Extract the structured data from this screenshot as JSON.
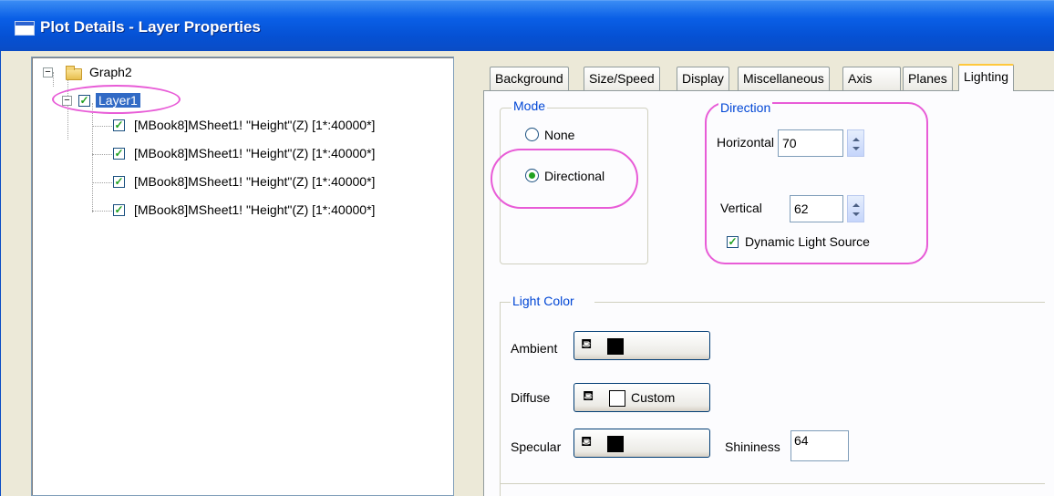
{
  "window": {
    "title": "Plot Details - Layer Properties"
  },
  "tree": {
    "root_label": "Graph2",
    "layer_label": "Layer1",
    "plots": [
      "[MBook8]MSheet1! \"Height\"(Z) [1*:40000*]",
      "[MBook8]MSheet1! \"Height\"(Z) [1*:40000*]",
      "[MBook8]MSheet1! \"Height\"(Z) [1*:40000*]",
      "[MBook8]MSheet1! \"Height\"(Z) [1*:40000*]"
    ]
  },
  "tabs": [
    "Background",
    "Size/Speed",
    "Display",
    "Miscellaneous",
    "Axis",
    "Planes",
    "Lighting"
  ],
  "active_tab": "Lighting",
  "mode": {
    "label": "Mode",
    "options": [
      "None",
      "Directional"
    ],
    "selected": "Directional"
  },
  "direction": {
    "label": "Direction",
    "horizontal_label": "Horizontal",
    "horizontal_value": "70",
    "vertical_label": "Vertical",
    "vertical_value": "62",
    "dynamic_label": "Dynamic Light Source",
    "dynamic_checked": true
  },
  "light_color": {
    "label": "Light Color",
    "ambient_label": "Ambient",
    "ambient_color": "#000000",
    "diffuse_label": "Diffuse",
    "diffuse_value": "Custom",
    "diffuse_color": "#ffffff",
    "specular_label": "Specular",
    "specular_color": "#000000",
    "shininess_label": "Shininess",
    "shininess_value": "64"
  },
  "colors": {
    "highlight": "#e85cd7",
    "selection": "#316ac5"
  }
}
